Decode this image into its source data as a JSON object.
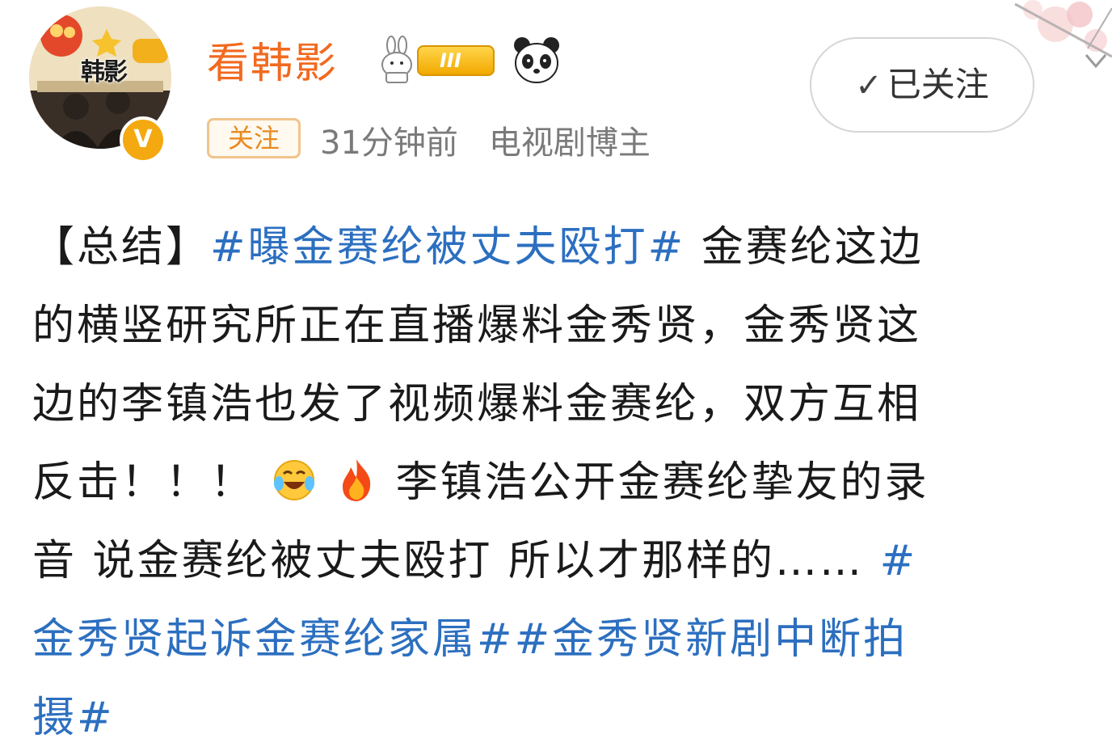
{
  "user": {
    "avatar_text": "韩影",
    "avatar_badge": "V",
    "name": "看韩影",
    "level": "III",
    "follow_tag": "关注",
    "time_ago": "31分钟前",
    "role": "电视剧博主"
  },
  "actions": {
    "followed_label": "已关注",
    "followed_icon": "checkmark-icon"
  },
  "post": {
    "line1_prefix": "【总结】",
    "line1_tag": "#曝金赛纶被丈夫殴打#",
    "line1_text": " 金赛纶这边",
    "line2": "的横竖研究所正在直播爆料金秀贤，金秀贤这",
    "line3": "边的李镇浩也发了视频爆料金赛纶，双方互相",
    "line4_a": "反击！！！",
    "line4_b": " 李镇浩公开金赛纶挚友的录",
    "line5_text": "音 说金赛纶被丈夫殴打 所以才那样的……",
    "line5_tag": " #",
    "line6_tag": "金秀贤起诉金赛纶家属##金秀贤新剧中断拍",
    "line7_tag": "摄#",
    "emojis": [
      "laughing-crying-emoji",
      "fire-emoji"
    ]
  },
  "colors": {
    "username": "#f16a1f",
    "hashtag": "#2c6fc0",
    "meta": "#7a7a7a",
    "level_badge": "#f2a900"
  }
}
